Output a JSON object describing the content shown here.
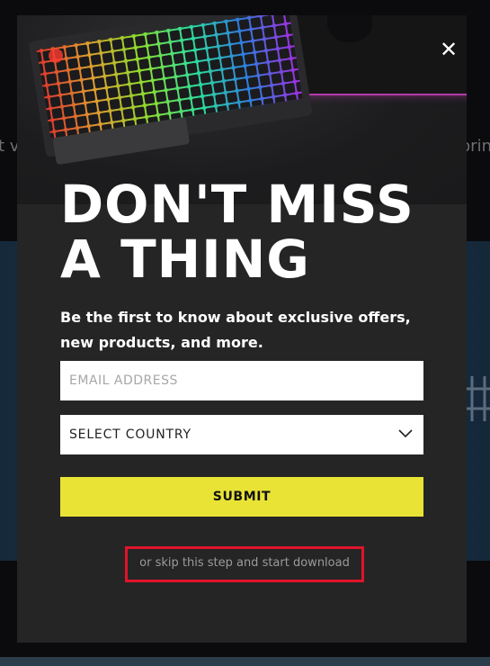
{
  "background": {
    "left_fragment": "t v",
    "right_fragment": "prin"
  },
  "modal": {
    "close_icon": "close-icon",
    "headline": "DON'T MISS A THING",
    "subtext": "Be the first to know about exclusive offers, new products, and more.",
    "email_placeholder": "EMAIL ADDRESS",
    "country_select_value": "SELECT COUNTRY",
    "submit_label": "SUBMIT",
    "skip_link": "or skip this step and start download",
    "colors": {
      "accent": "#e9e336",
      "highlight_border": "#e0142b",
      "modal_bg": "#252526"
    }
  }
}
